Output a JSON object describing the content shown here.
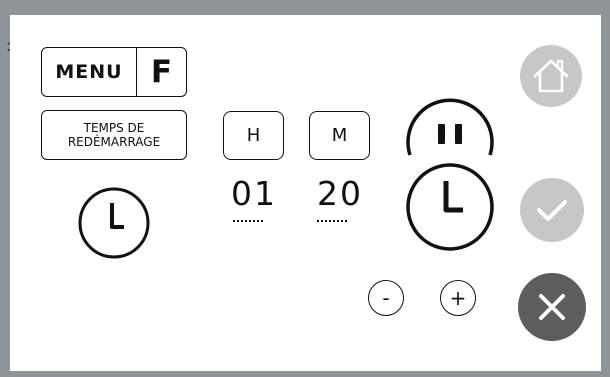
{
  "corner_mark": ":",
  "menu": {
    "label": "MENU",
    "f_label": "F"
  },
  "restart": {
    "line1": "TEMPS DE",
    "line2": "REDÉMARRAGE"
  },
  "hours": {
    "label": "H",
    "value": "01"
  },
  "minutes": {
    "label": "M",
    "value": "20"
  },
  "controls": {
    "minus": "-",
    "plus": "+"
  },
  "icons": {
    "home": "home-icon",
    "check": "check-icon",
    "close": "close-icon",
    "pause": "pause-icon",
    "clock": "clock-icon"
  },
  "colors": {
    "frame": "#8f9499",
    "disabled_button": "#c7c7c7",
    "close_button": "#5d5d5d",
    "foreground": "#111111"
  }
}
